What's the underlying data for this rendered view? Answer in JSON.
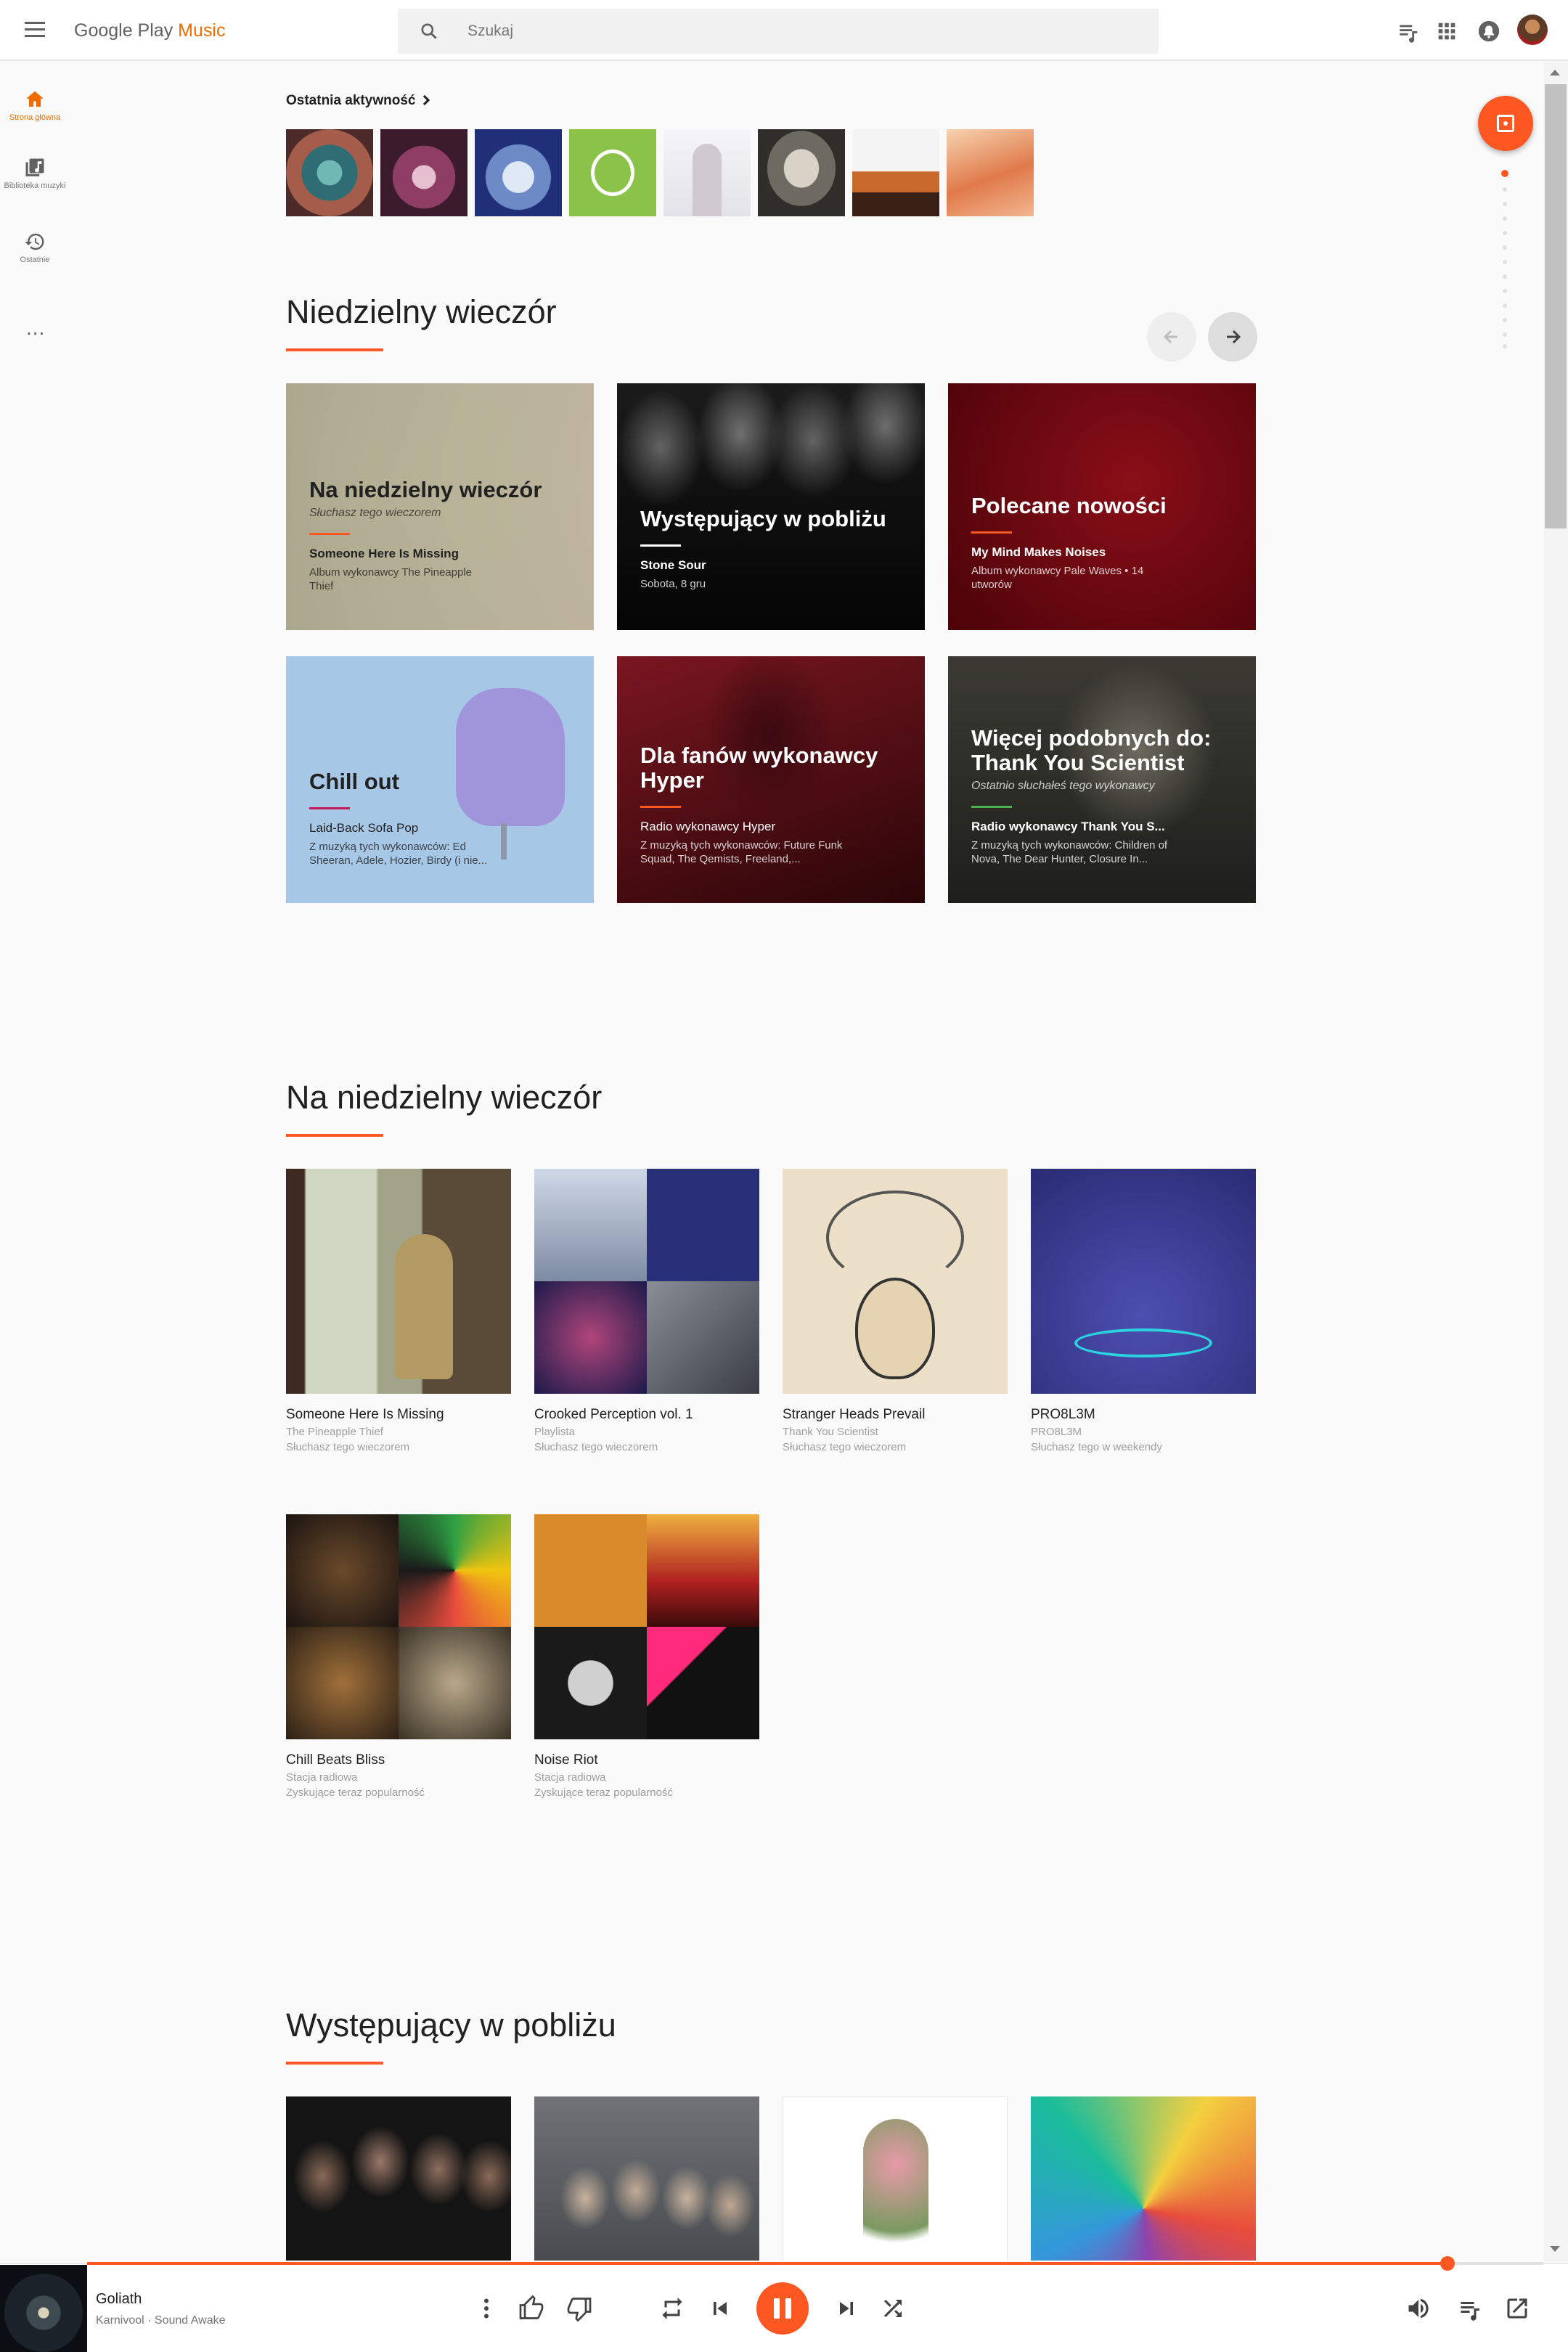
{
  "app": {
    "logo_prefix": "Google Play",
    "logo_suffix": "Music",
    "accent": "#ff5722"
  },
  "search": {
    "placeholder": "Szukaj"
  },
  "nav": {
    "items": [
      {
        "label": "Strona główna",
        "icon": "home-icon",
        "active": true
      },
      {
        "label": "Biblioteka muzyki",
        "icon": "library-icon",
        "active": false
      },
      {
        "label": "Ostatnie",
        "icon": "history-icon",
        "active": false
      }
    ],
    "more": "..."
  },
  "recent": {
    "heading": "Ostatnia aktywność",
    "thumb_count": 8
  },
  "section1": {
    "title": "Niedzielny wieczór",
    "cards": [
      {
        "title": "Na niedzielny wieczór",
        "reason": "Słuchasz tego wieczorem",
        "subtitle": "Someone Here Is Missing",
        "desc": "Album wykonawcy The Pineapple Thief"
      },
      {
        "title": "Występujący w pobliżu",
        "reason": "",
        "subtitle": "Stone Sour",
        "desc": "Sobota, 8 gru"
      },
      {
        "title": "Polecane nowości",
        "reason": "",
        "subtitle": "My Mind Makes Noises",
        "desc": "Album wykonawcy Pale Waves • 14 utworów"
      },
      {
        "title": "Chill out",
        "reason": "",
        "subtitle": "Laid-Back Sofa Pop",
        "desc": "Z muzyką tych wykonawców: Ed Sheeran, Adele, Hozier, Birdy (i nie..."
      },
      {
        "title": "Dla fanów wykonawcy Hyper",
        "reason": "",
        "subtitle": "Radio wykonawcy Hyper",
        "desc": "Z muzyką tych wykonawców: Future Funk Squad, The Qemists, Freeland,..."
      },
      {
        "title": "Więcej podobnych do: Thank You Scientist",
        "reason": "Ostatnio słuchałeś tego wykonawcy",
        "subtitle": "Radio wykonawcy Thank You S...",
        "desc": "Z muzyką tych wykonawców: Children of Nova, The Dear Hunter, Closure In..."
      }
    ]
  },
  "section2": {
    "title": "Na niedzielny wieczór",
    "albums": [
      {
        "title": "Someone Here Is Missing",
        "subtitle": "The Pineapple Thief",
        "reason": "Słuchasz tego wieczorem"
      },
      {
        "title": "Crooked Perception vol. 1",
        "subtitle": "Playlista",
        "reason": "Słuchasz tego wieczorem"
      },
      {
        "title": "Stranger Heads Prevail",
        "subtitle": "Thank You Scientist",
        "reason": "Słuchasz tego wieczorem"
      },
      {
        "title": "PRO8L3M",
        "subtitle": "PRO8L3M",
        "reason": "Słuchasz tego w weekendy"
      },
      {
        "title": "Chill Beats Bliss",
        "subtitle": "Stacja radiowa",
        "reason": "Zyskujące teraz popularność"
      },
      {
        "title": "Noise Riot",
        "subtitle": "Stacja radiowa",
        "reason": "Zyskujące teraz popularność"
      }
    ]
  },
  "section3": {
    "title": "Występujący w pobliżu"
  },
  "player": {
    "title": "Goliath",
    "artist": "Karnivool · Sound Awake",
    "progress": 0.934
  }
}
